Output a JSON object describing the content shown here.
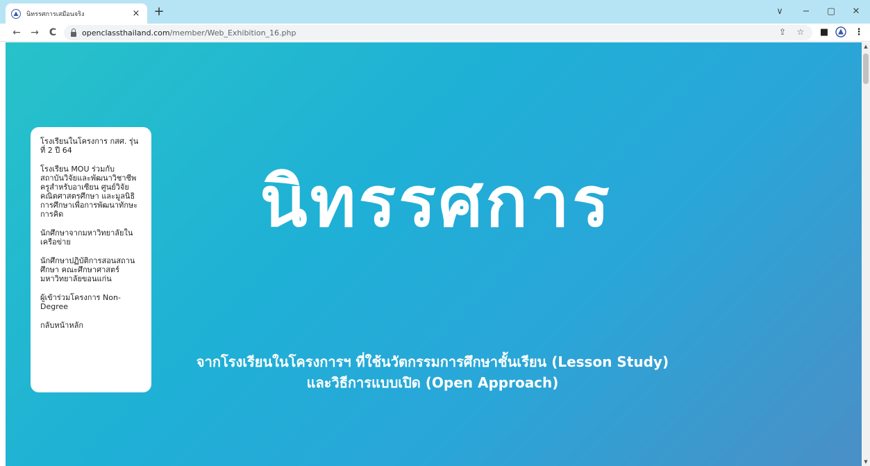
{
  "browser": {
    "tab": {
      "title": "นิทรรศการเสมือนจริง",
      "close": "×"
    },
    "new_tab": "+",
    "window_controls": {
      "collapse": "∨",
      "minimize": "−",
      "maximize": "▢",
      "close": "✕"
    },
    "nav": {
      "back": "←",
      "forward": "→",
      "reload": "C"
    },
    "address": {
      "host": "openclassthailand.com",
      "path": "/member/Web_Exhibition_16.php",
      "icons": [
        "share-icon",
        "star-icon",
        "sidepanel-icon",
        "profile-icon",
        "menu-kebab-icon"
      ]
    },
    "omnibox_glyphs": {
      "share": "⇪",
      "star": "☆",
      "sidepanel": "■",
      "menu": "⋮"
    }
  },
  "page": {
    "title": "นิทรรศการ",
    "subtitle_line1": "จากโรงเรียนในโครงการฯ ที่ใช้นวัตกรรมการศึกษาชั้นเรียน (Lesson Study)",
    "subtitle_line2": "และวิธีการแบบเปิด (Open Approach)",
    "menu": [
      "โรงเรียนในโครงการ กสศ. รุ่นที่ 2 ปี 64",
      "โรงเรียน MOU ร่วมกับสถาบันวิจัยและพัฒนาวิชาชีพครูสำหรับอาเซียน ศูนย์วิจัยคณิตศาสตรศึกษา และมูลนิธิการศึกษาเพื่อการพัฒนาทักษะการคิด",
      "นักศึกษาจากมหาวิทยาลัยในเครือข่าย",
      "นักศึกษาปฏิบัติการสอนสถานศึกษา คณะศึกษาศาสตร์ มหาวิทยาลัยขอนแก่น",
      "ผู้เข้าร่วมโครงการ Non-Degree",
      "กลับหน้าหลัก"
    ],
    "scroll_glyphs": {
      "up": "▲",
      "down": "▼"
    }
  },
  "colors": {
    "tabbar": "#b7e4f4",
    "gradient_start": "#27c2c9",
    "gradient_end": "#4a8fc6",
    "menu_bg": "#ffffff",
    "hero_text": "#ffffff"
  }
}
